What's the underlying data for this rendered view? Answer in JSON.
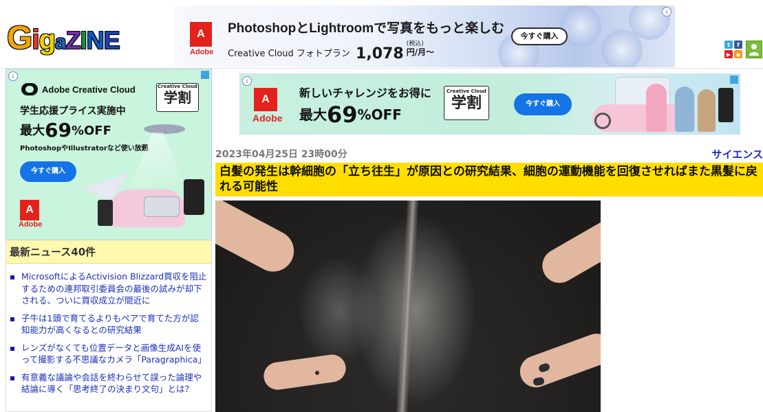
{
  "logo": {
    "text": "GIGAZINE"
  },
  "top_ad": {
    "brand": "Adobe",
    "headline": "PhotoshopとLightroomで写真をもっと楽しむ",
    "plan": "Creative Cloud フォトプラン",
    "price": "1,078",
    "tax_note": "(税込)",
    "unit": "円/月〜",
    "button": "今すぐ購入",
    "ad_info": "i"
  },
  "social": {
    "twitter": "t",
    "facebook": "f",
    "youtube": "▶",
    "rss": "◉"
  },
  "side_ad": {
    "brand": "Adobe Creative Cloud",
    "badge_top": "Creative Cloud",
    "badge_main": "学割",
    "line1": "学生応援プライス実施中",
    "line2_prefix": "最大",
    "line2_big": "69",
    "line2_suffix": "%OFF",
    "line3": "PhotoshopやIllustratorなど使い放題",
    "button": "今すぐ購入",
    "adobe": "Adobe"
  },
  "news": {
    "title": "最新ニュース40件",
    "items": [
      "MicrosoftによるActivision Blizzard買収を阻止するための連邦取引委員会の最後の試みが却下される、ついに買収成立が間近に",
      "子牛は1頭で育てるよりもペアで育てた方が認知能力が高くなるとの研究結果",
      "レンズがなくても位置データと画像生成AIを使って撮影する不思議なカメラ「Paragraphica」",
      "有意義な議論や会話を終わらせて誤った論理や結論に導く「思考終了の決まり文句」とは？"
    ]
  },
  "main_ad": {
    "adobe": "Adobe",
    "line1": "新しいチャレンジをお得に",
    "line2_prefix": "最大",
    "line2_big": "69",
    "line2_suffix": "%OFF",
    "badge_top": "Creative Cloud",
    "badge_main": "学割",
    "button": "今すぐ購入"
  },
  "article": {
    "date": "2023年04月25日 23時00分",
    "category": "サイエンス",
    "headline": "白髪の発生は幹細胞の「立ち往生」が原因との研究結果、細胞の運動機能を回復させればまた黒髪に戻れる可能性"
  }
}
